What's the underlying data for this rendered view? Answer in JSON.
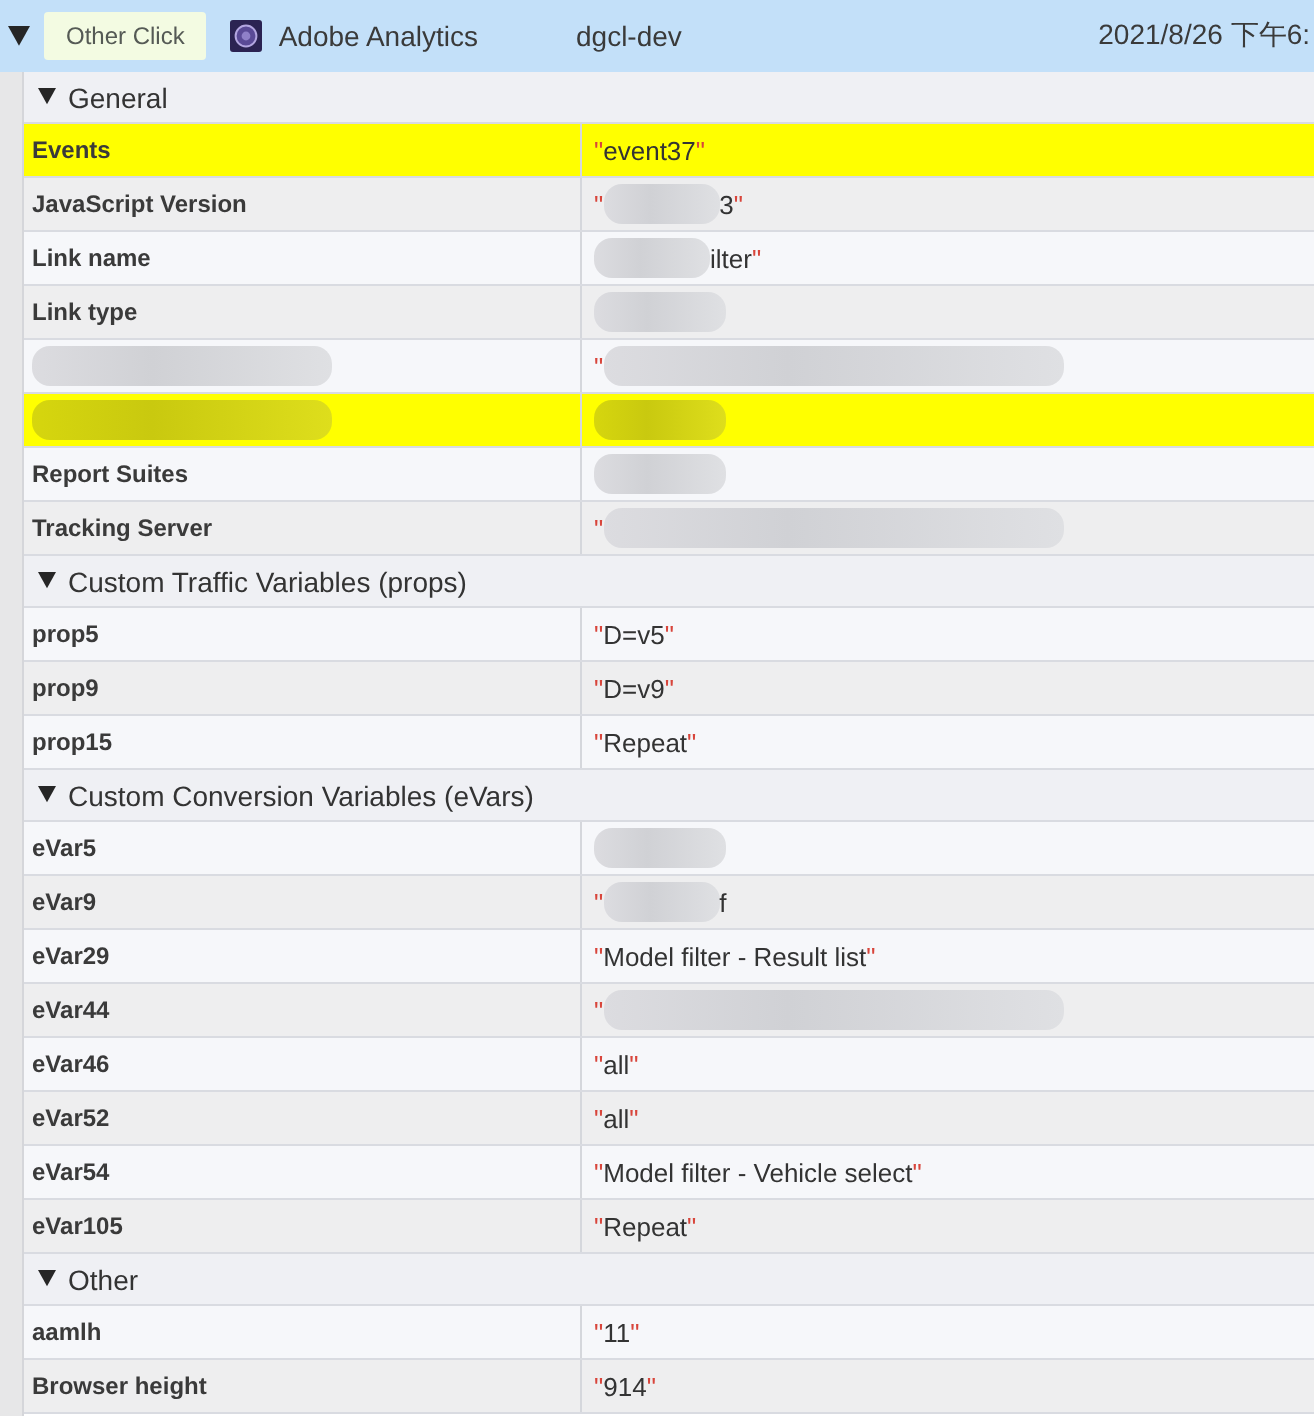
{
  "entry": {
    "expanded": true,
    "event_type": "Other Click",
    "tool": "Adobe Analytics",
    "account": "dgcl-dev",
    "timestamp": "2021/8/26 下午6:"
  },
  "sections": [
    {
      "title": "General",
      "expanded": true,
      "rows": [
        {
          "highlighted": true,
          "key": [
            {
              "kind": "plain",
              "text": "Events"
            }
          ],
          "value": [
            {
              "kind": "quote",
              "text": "\""
            },
            {
              "kind": "plain",
              "text": "event37"
            },
            {
              "kind": "quote",
              "text": "\""
            }
          ]
        },
        {
          "highlighted": false,
          "key": [
            {
              "kind": "plain",
              "text": "JavaScript Version"
            }
          ],
          "value": [
            {
              "kind": "quote",
              "text": "\""
            },
            {
              "kind": "blur"
            },
            {
              "kind": "plain",
              "text": "3"
            },
            {
              "kind": "quote",
              "text": "\""
            }
          ]
        },
        {
          "highlighted": false,
          "key": [
            {
              "kind": "plain",
              "text": "Link name"
            }
          ],
          "value": [
            {
              "kind": "blur"
            },
            {
              "kind": "plain",
              "text": "ilter"
            },
            {
              "kind": "quote",
              "text": "\""
            }
          ]
        },
        {
          "highlighted": false,
          "key": [
            {
              "kind": "plain",
              "text": "Link type"
            }
          ],
          "value": [
            {
              "kind": "blur"
            }
          ]
        },
        {
          "highlighted": false,
          "key": [
            {
              "kind": "blur"
            }
          ],
          "value": [
            {
              "kind": "quote",
              "text": "\""
            },
            {
              "kind": "blur"
            }
          ]
        },
        {
          "highlighted": true,
          "key": [
            {
              "kind": "blur"
            }
          ],
          "value": [
            {
              "kind": "blur"
            }
          ]
        },
        {
          "highlighted": false,
          "key": [
            {
              "kind": "plain",
              "text": "Report Suites"
            }
          ],
          "value": [
            {
              "kind": "blur"
            }
          ]
        },
        {
          "highlighted": false,
          "key": [
            {
              "kind": "plain",
              "text": "Tracking Server"
            }
          ],
          "value": [
            {
              "kind": "quote",
              "text": "\""
            },
            {
              "kind": "blur"
            }
          ]
        }
      ]
    },
    {
      "title": "Custom Traffic Variables (props)",
      "expanded": true,
      "rows": [
        {
          "highlighted": false,
          "key": [
            {
              "kind": "plain",
              "text": "prop5"
            }
          ],
          "value": [
            {
              "kind": "quote",
              "text": "\""
            },
            {
              "kind": "plain",
              "text": "D=v5"
            },
            {
              "kind": "quote",
              "text": "\""
            }
          ]
        },
        {
          "highlighted": false,
          "key": [
            {
              "kind": "plain",
              "text": "prop9"
            }
          ],
          "value": [
            {
              "kind": "quote",
              "text": "\""
            },
            {
              "kind": "plain",
              "text": "D=v9"
            },
            {
              "kind": "quote",
              "text": "\""
            }
          ]
        },
        {
          "highlighted": false,
          "key": [
            {
              "kind": "plain",
              "text": "prop15"
            }
          ],
          "value": [
            {
              "kind": "quote",
              "text": "\""
            },
            {
              "kind": "plain",
              "text": "Repeat"
            },
            {
              "kind": "quote",
              "text": "\""
            }
          ]
        }
      ]
    },
    {
      "title": "Custom Conversion Variables (eVars)",
      "expanded": true,
      "rows": [
        {
          "highlighted": false,
          "key": [
            {
              "kind": "plain",
              "text": "eVar5"
            }
          ],
          "value": [
            {
              "kind": "blur"
            }
          ]
        },
        {
          "highlighted": false,
          "key": [
            {
              "kind": "plain",
              "text": "eVar9"
            }
          ],
          "value": [
            {
              "kind": "quote",
              "text": "\""
            },
            {
              "kind": "blur"
            },
            {
              "kind": "plain",
              "text": "f"
            }
          ]
        },
        {
          "highlighted": false,
          "key": [
            {
              "kind": "plain",
              "text": "eVar29"
            }
          ],
          "value": [
            {
              "kind": "quote",
              "text": "\""
            },
            {
              "kind": "plain",
              "text": "Model filter - Result list"
            },
            {
              "kind": "quote",
              "text": "\""
            }
          ]
        },
        {
          "highlighted": false,
          "key": [
            {
              "kind": "plain",
              "text": "eVar44"
            }
          ],
          "value": [
            {
              "kind": "quote",
              "text": "\""
            },
            {
              "kind": "blur"
            }
          ]
        },
        {
          "highlighted": false,
          "key": [
            {
              "kind": "plain",
              "text": "eVar46"
            }
          ],
          "value": [
            {
              "kind": "quote",
              "text": "\""
            },
            {
              "kind": "plain",
              "text": "all"
            },
            {
              "kind": "quote",
              "text": "\""
            }
          ]
        },
        {
          "highlighted": false,
          "key": [
            {
              "kind": "plain",
              "text": "eVar52"
            }
          ],
          "value": [
            {
              "kind": "quote",
              "text": "\""
            },
            {
              "kind": "plain",
              "text": "all"
            },
            {
              "kind": "quote",
              "text": "\""
            }
          ]
        },
        {
          "highlighted": false,
          "key": [
            {
              "kind": "plain",
              "text": "eVar54"
            }
          ],
          "value": [
            {
              "kind": "quote",
              "text": "\""
            },
            {
              "kind": "plain",
              "text": "Model filter - Vehicle select"
            },
            {
              "kind": "quote",
              "text": "\""
            }
          ]
        },
        {
          "highlighted": false,
          "key": [
            {
              "kind": "plain",
              "text": "eVar105"
            }
          ],
          "value": [
            {
              "kind": "quote",
              "text": "\""
            },
            {
              "kind": "plain",
              "text": "Repeat"
            },
            {
              "kind": "quote",
              "text": "\""
            }
          ]
        }
      ]
    },
    {
      "title": "Other",
      "expanded": true,
      "rows": [
        {
          "highlighted": false,
          "key": [
            {
              "kind": "plain",
              "text": "aamlh"
            }
          ],
          "value": [
            {
              "kind": "quote",
              "text": "\""
            },
            {
              "kind": "plain",
              "text": "11"
            },
            {
              "kind": "quote",
              "text": "\""
            }
          ]
        },
        {
          "highlighted": false,
          "key": [
            {
              "kind": "plain",
              "text": "Browser height"
            }
          ],
          "value": [
            {
              "kind": "quote",
              "text": "\""
            },
            {
              "kind": "plain",
              "text": "914"
            },
            {
              "kind": "quote",
              "text": "\""
            }
          ]
        }
      ]
    }
  ]
}
